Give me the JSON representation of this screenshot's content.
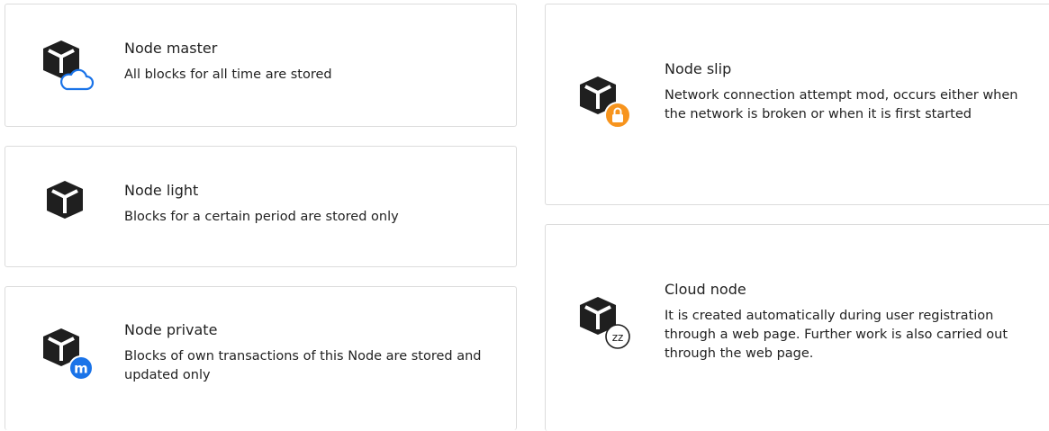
{
  "cards": [
    {
      "title": "Node master",
      "description": "All blocks for all time are stored",
      "icon": "cube-cloud-icon",
      "badge_color": "#1a73e8"
    },
    {
      "title": "Node light",
      "description": "Blocks for a certain period are stored only",
      "icon": "cube-icon"
    },
    {
      "title": "Node private",
      "description": "Blocks of own transactions of this Node are stored and updated only",
      "icon": "cube-m-badge-icon",
      "badge_color": "#1a73e8",
      "badge_text": "m"
    },
    {
      "title": "Node slip",
      "description": "Network connection attempt mod, occurs either when the network is broken or when it is first started",
      "icon": "cube-lock-icon",
      "badge_color": "#f7941d"
    },
    {
      "title": "Cloud node",
      "description": "It is created automatically during user registration through a web page. Further work is also carried out through the web page.",
      "icon": "cube-sleep-icon",
      "badge_text": "zz"
    }
  ],
  "colors": {
    "cube": "#1f1f1f",
    "border": "#dcdcdc",
    "blue": "#1a73e8",
    "orange": "#f7941d"
  }
}
